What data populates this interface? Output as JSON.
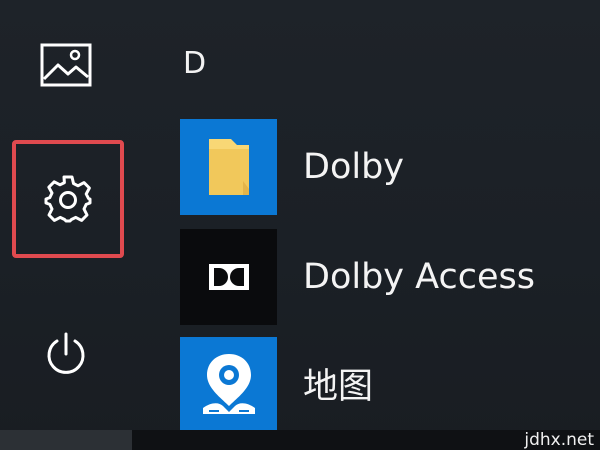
{
  "rail": {
    "items": [
      {
        "name": "photos",
        "icon": "picture-icon"
      },
      {
        "name": "settings",
        "icon": "gear-icon",
        "highlight_color": "#e04a4f"
      },
      {
        "name": "power",
        "icon": "power-icon"
      }
    ]
  },
  "app_list": {
    "section_letter": "D",
    "apps": [
      {
        "label": "Dolby",
        "icon": "folder-icon",
        "tile_color": "#0b78d4"
      },
      {
        "label": "Dolby Access",
        "icon": "dolby-logo-icon",
        "tile_color": "#0a0b0d"
      },
      {
        "label": "地图",
        "icon": "map-pin-icon",
        "tile_color": "#0b78d4"
      }
    ]
  },
  "watermark": "jdhx.net"
}
